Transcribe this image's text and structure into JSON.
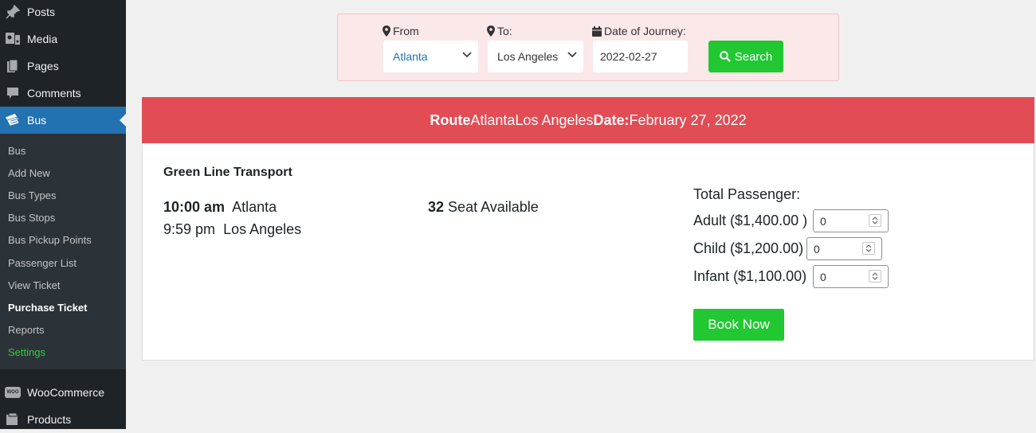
{
  "sidebar": {
    "menu": [
      {
        "label": "Posts",
        "icon": "pin-icon"
      },
      {
        "label": "Media",
        "icon": "media-icon"
      },
      {
        "label": "Pages",
        "icon": "pages-icon"
      },
      {
        "label": "Comments",
        "icon": "comment-icon"
      },
      {
        "label": "Bus",
        "icon": "ticket-icon"
      }
    ],
    "submenu": [
      {
        "label": "Bus"
      },
      {
        "label": "Add New"
      },
      {
        "label": "Bus Types"
      },
      {
        "label": "Bus Stops"
      },
      {
        "label": "Bus Pickup Points"
      },
      {
        "label": "Passenger List"
      },
      {
        "label": "View Ticket"
      },
      {
        "label": "Purchase Ticket"
      },
      {
        "label": "Settings"
      }
    ],
    "bottom_menu": [
      {
        "label": "WooCommerce",
        "icon": "woo-icon",
        "icon_text": "WOO"
      },
      {
        "label": "Products",
        "icon": "products-icon"
      }
    ]
  },
  "search": {
    "from_label": "From",
    "from_value": "Atlanta",
    "to_label": "To:",
    "to_value": "Los Angeles",
    "date_label": "Date of Journey:",
    "date_value": "2022-02-27",
    "button_label": "Search"
  },
  "route_bar": {
    "route_label": "Route",
    "from": "Atlanta",
    "to": "Los Angeles",
    "date_label": "Date:",
    "date": "February 27, 2022"
  },
  "result": {
    "company": "Green Line Transport",
    "departure_time": "10:00 am",
    "departure_place": "Atlanta",
    "arrival_time": "9:59 pm",
    "arrival_place": "Los Angeles",
    "seats_count": "32",
    "seats_label": "Seat Available",
    "total_passenger_label": "Total Passenger:",
    "adult_label": "Adult ($1,400.00 )",
    "adult_value": "0",
    "child_label": "Child ($1,200.00)",
    "child_value": "0",
    "infant_label": "Infant ($1,100.00)",
    "infant_value": "0",
    "book_button": "Book Now"
  },
  "colors": {
    "sidebar_bg": "#1d2327",
    "active_menu": "#2271b1",
    "route_bar": "#e24c55",
    "green_button": "#21c831",
    "search_panel_bg": "#fbe8e9"
  }
}
